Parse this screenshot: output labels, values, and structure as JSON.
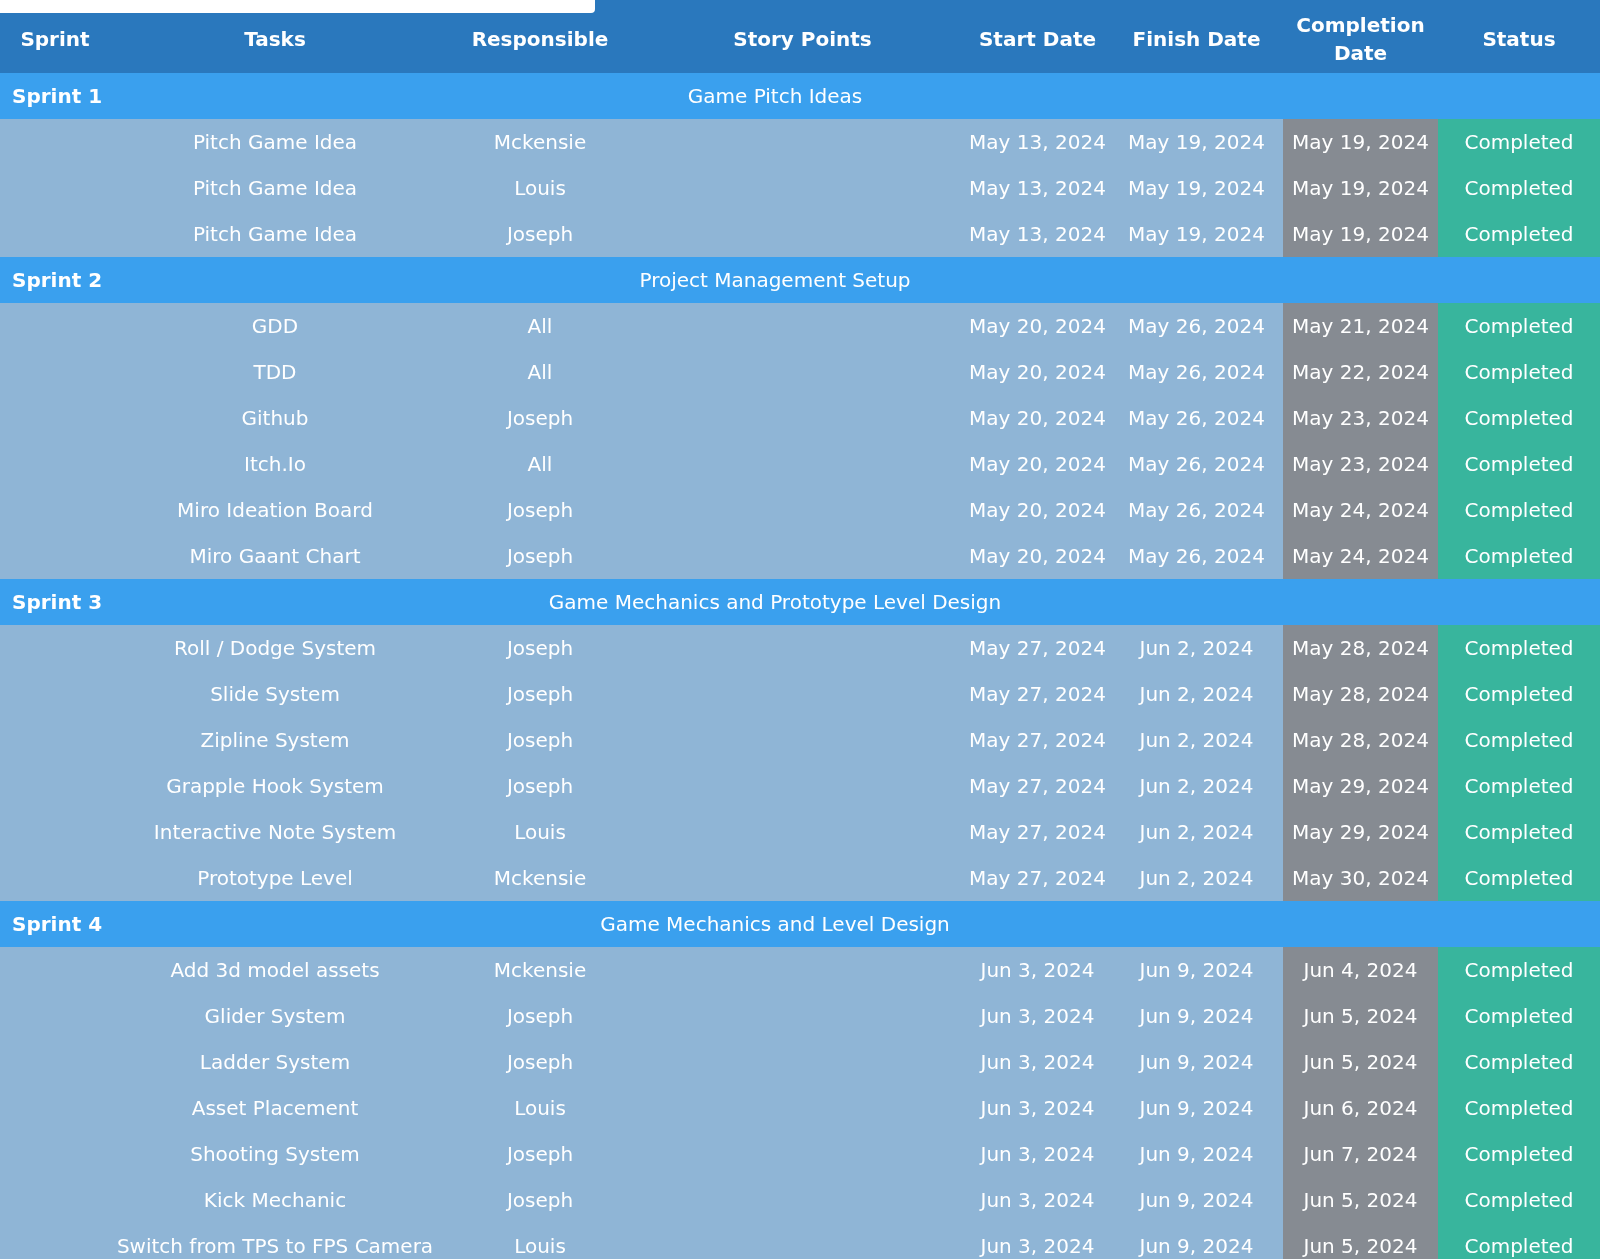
{
  "columns": [
    "Sprint",
    "Tasks",
    "Responsible",
    "Story Points",
    "Start Date",
    "Finish Date",
    "Completion Date",
    "Status"
  ],
  "sprints": [
    {
      "name": "Sprint 1",
      "title": "Game Pitch Ideas",
      "tasks": [
        {
          "task": "Pitch Game Idea",
          "responsible": "Mckensie",
          "start": "May 13, 2024",
          "finish": "May 19, 2024",
          "completion": "May 19, 2024",
          "status": "Completed"
        },
        {
          "task": "Pitch Game Idea",
          "responsible": "Louis",
          "start": "May 13, 2024",
          "finish": "May 19, 2024",
          "completion": "May 19, 2024",
          "status": "Completed"
        },
        {
          "task": "Pitch Game Idea",
          "responsible": "Joseph",
          "start": "May 13, 2024",
          "finish": "May 19, 2024",
          "completion": "May 19, 2024",
          "status": "Completed"
        }
      ]
    },
    {
      "name": "Sprint 2",
      "title": "Project Management Setup",
      "tasks": [
        {
          "task": "GDD",
          "responsible": "All",
          "start": "May 20, 2024",
          "finish": "May 26, 2024",
          "completion": "May 21, 2024",
          "status": "Completed"
        },
        {
          "task": "TDD",
          "responsible": "All",
          "start": "May 20, 2024",
          "finish": "May 26, 2024",
          "completion": "May 22, 2024",
          "status": "Completed"
        },
        {
          "task": "Github",
          "responsible": "Joseph",
          "start": "May 20, 2024",
          "finish": "May 26, 2024",
          "completion": "May 23, 2024",
          "status": "Completed"
        },
        {
          "task": "Itch.Io",
          "responsible": "All",
          "start": "May 20, 2024",
          "finish": "May 26, 2024",
          "completion": "May 23, 2024",
          "status": "Completed"
        },
        {
          "task": "Miro Ideation Board",
          "responsible": "Joseph",
          "start": "May 20, 2024",
          "finish": "May 26, 2024",
          "completion": "May 24, 2024",
          "status": "Completed"
        },
        {
          "task": "Miro Gaant Chart",
          "responsible": "Joseph",
          "start": "May 20, 2024",
          "finish": "May 26, 2024",
          "completion": "May 24, 2024",
          "status": "Completed"
        }
      ]
    },
    {
      "name": "Sprint 3",
      "title": "Game Mechanics and Prototype Level Design",
      "tasks": [
        {
          "task": "Roll / Dodge System",
          "responsible": "Joseph",
          "start": "May 27, 2024",
          "finish": "Jun 2, 2024",
          "completion": "May 28, 2024",
          "status": "Completed"
        },
        {
          "task": "Slide System",
          "responsible": "Joseph",
          "start": "May 27, 2024",
          "finish": "Jun 2, 2024",
          "completion": "May 28, 2024",
          "status": "Completed"
        },
        {
          "task": "Zipline System",
          "responsible": "Joseph",
          "start": "May 27, 2024",
          "finish": "Jun 2, 2024",
          "completion": "May 28, 2024",
          "status": "Completed"
        },
        {
          "task": "Grapple Hook System",
          "responsible": "Joseph",
          "start": "May 27, 2024",
          "finish": "Jun 2, 2024",
          "completion": "May 29, 2024",
          "status": "Completed"
        },
        {
          "task": "Interactive Note System",
          "responsible": "Louis",
          "start": "May 27, 2024",
          "finish": "Jun 2, 2024",
          "completion": "May 29, 2024",
          "status": "Completed"
        },
        {
          "task": "Prototype Level",
          "responsible": "Mckensie",
          "start": "May 27, 2024",
          "finish": "Jun 2, 2024",
          "completion": "May 30, 2024",
          "status": "Completed"
        }
      ]
    },
    {
      "name": "Sprint 4",
      "title": "Game Mechanics and Level Design",
      "tasks": [
        {
          "task": "Add 3d model assets",
          "responsible": "Mckensie",
          "start": "Jun 3, 2024",
          "finish": "Jun 9, 2024",
          "completion": "Jun 4, 2024",
          "status": "Completed"
        },
        {
          "task": "Glider System",
          "responsible": "Joseph",
          "start": "Jun 3, 2024",
          "finish": "Jun 9, 2024",
          "completion": "Jun 5, 2024",
          "status": "Completed"
        },
        {
          "task": "Ladder System",
          "responsible": "Joseph",
          "start": "Jun 3, 2024",
          "finish": "Jun 9, 2024",
          "completion": "Jun 5, 2024",
          "status": "Completed"
        },
        {
          "task": "Asset Placement",
          "responsible": "Louis",
          "start": "Jun 3, 2024",
          "finish": "Jun 9, 2024",
          "completion": "Jun 6, 2024",
          "status": "Completed"
        },
        {
          "task": "Shooting System",
          "responsible": "Joseph",
          "start": "Jun 3, 2024",
          "finish": "Jun 9, 2024",
          "completion": "Jun 7, 2024",
          "status": "Completed"
        },
        {
          "task": "Kick Mechanic",
          "responsible": "Joseph",
          "start": "Jun 3, 2024",
          "finish": "Jun 9, 2024",
          "completion": "Jun 5, 2024",
          "status": "Completed"
        },
        {
          "task": "Switch from TPS to FPS Camera",
          "responsible": "Louis",
          "start": "Jun 3, 2024",
          "finish": "Jun 9, 2024",
          "completion": "Jun 5, 2024",
          "status": "Completed"
        }
      ]
    }
  ]
}
